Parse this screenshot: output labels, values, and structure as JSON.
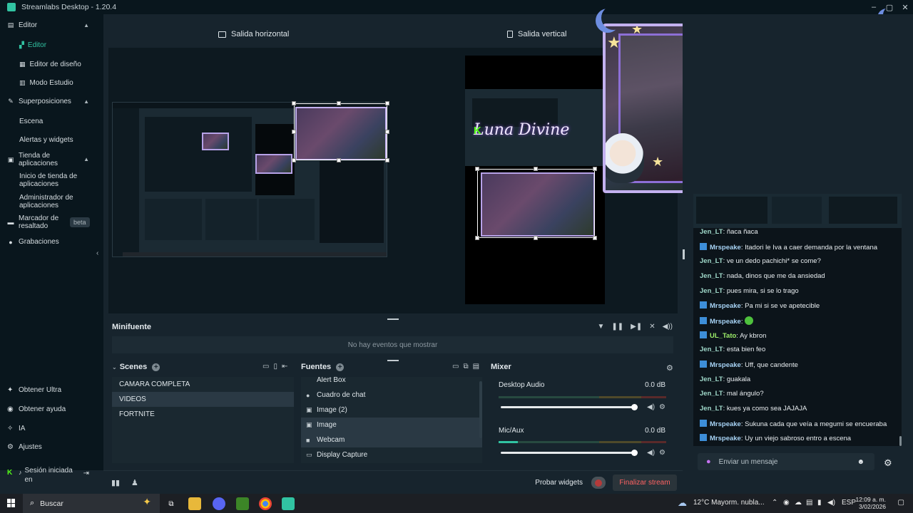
{
  "window": {
    "title": "Streamlabs Desktop - 1.20.4",
    "controls": [
      "–",
      "▢",
      "✕"
    ]
  },
  "sidebar": {
    "editor_label": "Editor",
    "editor_items": [
      "Editor",
      "Editor de diseño",
      "Modo Estudio"
    ],
    "overlays_label": "Superposiciones",
    "overlays_items": [
      "Escena",
      "Alertas y widgets"
    ],
    "appstore_label": "Tienda de aplicaciones",
    "appstore_items": [
      "Inicio de tienda de aplicaciones",
      "Administrador de aplicaciones"
    ],
    "highlighter_label": "Marcador de resaltado",
    "highlighter_badge": "beta",
    "recordings_label": "Grabaciones",
    "bottom": {
      "ultra": "Obtener Ultra",
      "help": "Obtener ayuda",
      "ai": "IA",
      "settings": "Ajustes",
      "session": "Sesión iniciada en"
    },
    "active_color": "#31c3a2"
  },
  "editor": {
    "horizontal_label": "Salida horizontal",
    "vertical_label": "Salida vertical"
  },
  "overlay": {
    "brand_text": "Luna Divine"
  },
  "minifeed": {
    "title": "Minifuente",
    "empty": "No hay eventos que mostrar"
  },
  "scenes": {
    "title": "Scenes",
    "items": [
      "CAMARA COMPLETA",
      "VIDEOS",
      "FORTNITE"
    ],
    "selected_index": 1
  },
  "sources": {
    "title": "Fuentes",
    "items": [
      {
        "label": "Alert Box",
        "icon": "alert-icon"
      },
      {
        "label": "Cuadro de chat",
        "icon": "chat-icon"
      },
      {
        "label": "Image (2)",
        "icon": "image-icon"
      },
      {
        "label": "Image",
        "icon": "image-icon"
      },
      {
        "label": "Webcam",
        "icon": "webcam-icon"
      },
      {
        "label": "Display Capture",
        "icon": "monitor-icon"
      }
    ]
  },
  "mixer": {
    "title": "Mixer",
    "channels": [
      {
        "name": "Desktop Audio",
        "db": "0.0 dB",
        "volume": 1.0
      },
      {
        "name": "Mic/Aux",
        "db": "0.0 dB",
        "volume": 1.0
      }
    ]
  },
  "footer": {
    "test_widgets": "Probar widgets",
    "end_stream": "Finalizar stream"
  },
  "chat": {
    "messages": [
      {
        "user": "Jen_LT",
        "text": "ñaca ñaca",
        "badge": false
      },
      {
        "user": "Mrspeake",
        "text": "Itadori le Iva a caer demanda por la ventana",
        "badge": true
      },
      {
        "user": "Jen_LT",
        "text": "ve un dedo pachichi* se come?",
        "badge": false
      },
      {
        "user": "Jen_LT",
        "text": "nada, dinos que me da ansiedad",
        "badge": false
      },
      {
        "user": "Jen_LT",
        "text": "pues mira, si se lo trago",
        "badge": false
      },
      {
        "user": "Mrspeake",
        "text": "Pa mi si se ve apetecible",
        "badge": true
      },
      {
        "user": "Mrspeake",
        "text": "",
        "badge": true,
        "emote": true
      },
      {
        "user": "UL_Tato",
        "text": "Ay kbron",
        "badge": true
      },
      {
        "user": "Jen_LT",
        "text": "esta bien feo",
        "badge": false
      },
      {
        "user": "Mrspeake",
        "text": "Uff, que candente",
        "badge": true
      },
      {
        "user": "Jen_LT",
        "text": "guakala",
        "badge": false
      },
      {
        "user": "Jen_LT",
        "text": "mal ángulo?",
        "badge": false
      },
      {
        "user": "Jen_LT",
        "text": "kues ya como sea JAJAJA",
        "badge": false
      },
      {
        "user": "Mrspeake",
        "text": "Sukuna cada que veía a megumi se encueraba",
        "badge": true
      },
      {
        "user": "Mrspeake",
        "text": "Uy un viejo sabroso entro a escena",
        "badge": true
      }
    ],
    "input_placeholder": "Enviar un mensaje"
  },
  "taskbar": {
    "search_placeholder": "Buscar",
    "weather": "12°C  Mayorm. nubla...",
    "lang": "ESP",
    "time": "12:09 a. m.",
    "date": "3/02/2026"
  }
}
